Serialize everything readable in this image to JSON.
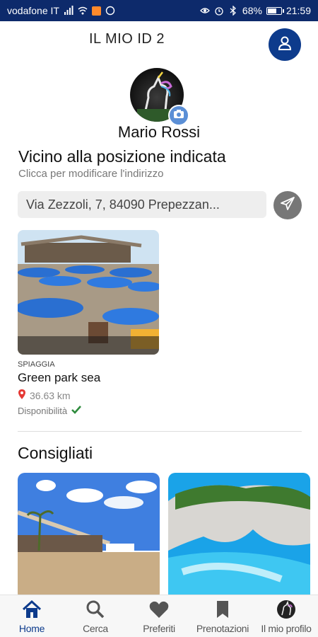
{
  "status_bar": {
    "carrier": "vodafone IT",
    "battery": "68%",
    "battery_level": 0.68,
    "time": "21:59"
  },
  "header": {
    "title": "IL MIO ID  2"
  },
  "user": {
    "name": "Mario Rossi"
  },
  "location": {
    "title": "Vicino alla posizione indicata",
    "subtitle": "Clicca per modificare l'indirizzo",
    "address_value": "Via Zezzoli, 7, 84090 Prepezzan..."
  },
  "nearby": {
    "category": "SPIAGGIA",
    "name": "Green park sea",
    "distance": "36.63 km",
    "availability_label": "Disponibilità"
  },
  "recommended": {
    "title": "Consigliati"
  },
  "bottom_nav": {
    "items": [
      {
        "label": "Home",
        "icon": "home-icon"
      },
      {
        "label": "Cerca",
        "icon": "search-icon"
      },
      {
        "label": "Preferiti",
        "icon": "heart-icon"
      },
      {
        "label": "Prenotazioni",
        "icon": "bookmark-icon"
      },
      {
        "label": "Il mio profilo",
        "icon": "avatar-icon"
      }
    ]
  },
  "colors": {
    "status_bar": "#0d2a6b",
    "accent": "#0d3b8c",
    "camera_badge": "#5b8fd6",
    "available": "#2e8b3d",
    "pin": "#e53935"
  }
}
